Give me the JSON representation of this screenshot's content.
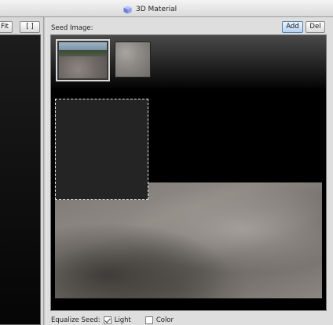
{
  "window": {
    "title": "3D Material",
    "title_icon": "cube-icon",
    "accent": "#7a8fe0"
  },
  "left_panel": {
    "fit_label": "Fit",
    "bracket_label": "[ ]"
  },
  "seed": {
    "label": "Seed Image:",
    "add_label": "Add",
    "del_label": "Del",
    "thumbnails": [
      {
        "name": "dirt-road-photo",
        "selected": true
      },
      {
        "name": "gravel-texture",
        "selected": false
      }
    ]
  },
  "footer": {
    "equalize_label": "Equalize Seed:",
    "light_label": "Light",
    "light_checked": true,
    "color_label": "Color",
    "color_checked": false
  }
}
